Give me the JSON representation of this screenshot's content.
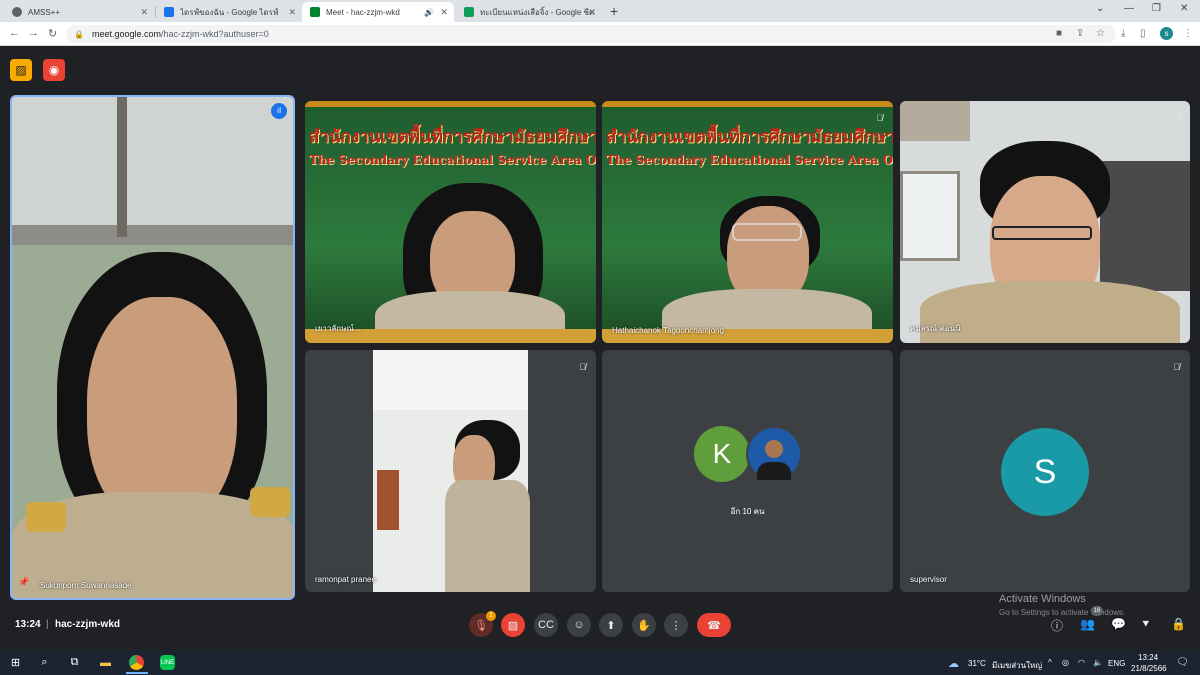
{
  "browser": {
    "tabs": [
      {
        "label": "AMSS++",
        "favicon_color": "#5f6368"
      },
      {
        "label": "ไดรฟ์ของฉัน - Google ไดรฟ์",
        "favicon_color": "#1a73e8"
      },
      {
        "label": "Meet - hac-zzjm-wkd",
        "favicon_color": "#00832d"
      },
      {
        "label": "ทะเบียนแหน่งเสือจิ้ง - Google ชีต",
        "favicon_color": "#0f9d58"
      }
    ],
    "url_host": "meet.google.com",
    "url_path": "/hac-zzjm-wkd?authuser=0",
    "profile_initial": "s"
  },
  "meet": {
    "participants": [
      {
        "name": "Sukunporn Suwannasade",
        "pinned": true,
        "speaking": true
      },
      {
        "name": "เยาวลักษณ์ ..."
      },
      {
        "name": "Hathaichanok Tagoonchamjong",
        "muted": true
      },
      {
        "name": "คมสรณ์ ค่อนนี",
        "muted": true
      },
      {
        "name": "ramonpat pranee",
        "muted": true
      },
      {
        "name": "อีก 10 คน",
        "avatar_initial": "K",
        "avatar_color": "#5f9e3b"
      },
      {
        "name": "supervisor",
        "avatar_initial": "S",
        "avatar_color": "#1a9aa7",
        "muted": true
      }
    ],
    "board_thai": "สำนักงานเขตพื้นที่การศึกษามัธยมศึกษานครร",
    "board_eng": "The Secondary Educational Service Area Office Nakho",
    "time": "13:24",
    "meeting_code": "hac-zzjm-wkd",
    "notification_count": "1",
    "people_count": "16",
    "activation_title": "Activate Windows",
    "activation_sub": "Go to Settings to activate Windows."
  },
  "taskbar": {
    "weather": "31°C",
    "weather_text": "มีเมฆส่วนใหญ่",
    "language": "ENG",
    "time": "13:24",
    "date": "21/8/2566"
  },
  "colors": {
    "meet_bg": "#202124",
    "tile_bg": "#3c4043",
    "hangup": "#ea4335",
    "active_border": "#8ab4f8"
  }
}
